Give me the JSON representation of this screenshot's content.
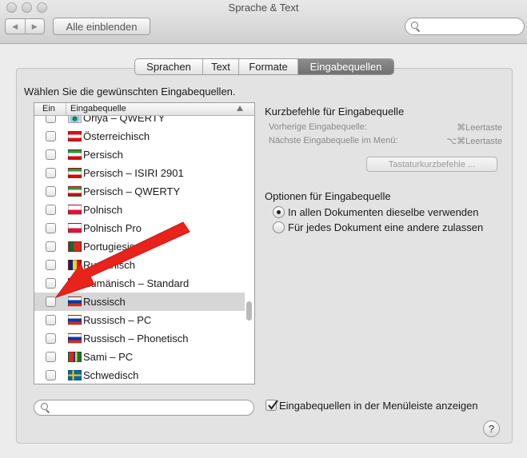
{
  "window": {
    "title": "Sprache & Text"
  },
  "toolbar": {
    "show_all_label": "Alle einblenden",
    "back_icon": "◀",
    "forward_icon": "▶"
  },
  "tabs": [
    {
      "label": "Sprachen",
      "active": false
    },
    {
      "label": "Text",
      "active": false
    },
    {
      "label": "Formate",
      "active": false
    },
    {
      "label": "Eingabequellen",
      "active": true
    }
  ],
  "main": {
    "instruction": "Wählen Sie die gewünschten Eingabequellen.",
    "list": {
      "col_enabled": "Ein",
      "col_source": "Eingabequelle",
      "rows": [
        {
          "label": "Oriya – QWERTY",
          "flag": "oriya",
          "checked": false,
          "selected": false
        },
        {
          "label": "Österreichisch",
          "flag": "austria",
          "checked": false,
          "selected": false
        },
        {
          "label": "Persisch",
          "flag": "iran",
          "checked": false,
          "selected": false
        },
        {
          "label": "Persisch – ISIRI 2901",
          "flag": "iran-isiri",
          "checked": false,
          "selected": false
        },
        {
          "label": "Persisch – QWERTY",
          "flag": "iran",
          "checked": false,
          "selected": false
        },
        {
          "label": "Polnisch",
          "flag": "poland",
          "checked": false,
          "selected": false
        },
        {
          "label": "Polnisch Pro",
          "flag": "poland-pro",
          "checked": false,
          "selected": false
        },
        {
          "label": "Portugiesisch",
          "flag": "portugal",
          "checked": false,
          "selected": false
        },
        {
          "label": "Rumänisch",
          "flag": "romania",
          "checked": false,
          "selected": false
        },
        {
          "label": "Rumänisch – Standard",
          "flag": "romania",
          "checked": false,
          "selected": false
        },
        {
          "label": "Russisch",
          "flag": "russia",
          "checked": false,
          "selected": true
        },
        {
          "label": "Russisch – PC",
          "flag": "russia-pc",
          "checked": false,
          "selected": false
        },
        {
          "label": "Russisch – Phonetisch",
          "flag": "russia",
          "checked": false,
          "selected": false
        },
        {
          "label": "Sami – PC",
          "flag": "sami",
          "checked": false,
          "selected": false
        },
        {
          "label": "Schwedisch",
          "flag": "sweden",
          "checked": false,
          "selected": false
        }
      ],
      "scroll_position": 0.7
    },
    "shortcuts": {
      "heading": "Kurzbefehle für Eingabequelle",
      "prev_label": "Vorherige Eingabequelle:",
      "prev_key": "⌘Leertaste",
      "next_label": "Nächste Eingabequelle im Menü:",
      "next_key": "⌥⌘Leertaste",
      "button_label": "Tastaturkurzbefehle ..."
    },
    "options": {
      "heading": "Optionen für Eingabequelle",
      "radio_all": "In allen Dokumenten dieselbe verwenden",
      "radio_each": "Für jedes Dokument eine andere zulassen",
      "selected": "all"
    },
    "menu_checkbox_label": "Eingabequellen in der Menüleiste anzeigen",
    "menu_checkbox_checked": true,
    "help_label": "?"
  },
  "annotation": {
    "color": "#e8231c"
  }
}
